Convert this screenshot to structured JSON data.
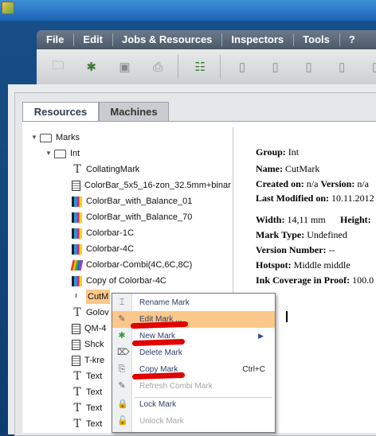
{
  "menubar": {
    "items": [
      "File",
      "Edit",
      "Jobs & Resources",
      "Inspectors",
      "Tools",
      "?"
    ]
  },
  "toolbar": {
    "icons": [
      "open-folder-icon",
      "add-resource-icon",
      "save-icon",
      "print-icon",
      "tree-icon",
      "doc-icon",
      "doc-icon",
      "doc-icon",
      "doc-icon",
      "doc-icon",
      "doc-icon",
      "doc-icon"
    ]
  },
  "tabs": {
    "resources": "Resources",
    "machines": "Machines"
  },
  "tree": {
    "root": "Marks",
    "folder": "Int",
    "items": [
      {
        "label": "CollatingMark"
      },
      {
        "label": "ColorBar_5x5_16-zon_32.5mm+binar"
      },
      {
        "label": "ColorBar_with_Balance_01"
      },
      {
        "label": "ColorBar_with_Balance_70"
      },
      {
        "label": "Colorbar-1C"
      },
      {
        "label": "Colorbar-4C"
      },
      {
        "label": "Colorbar-Combi(4C,6C,8C)"
      },
      {
        "label": "Copy of Colorbar-4C"
      },
      {
        "label": "CutM"
      },
      {
        "label": "Golov"
      },
      {
        "label": "QM-4"
      },
      {
        "label": "Shck"
      },
      {
        "label": "T-kre"
      },
      {
        "label": "Text"
      },
      {
        "label": "Text"
      },
      {
        "label": "Text"
      },
      {
        "label": "Text"
      }
    ]
  },
  "details": {
    "group_label": "Group:",
    "group_value": "Int",
    "name_label": "Name:",
    "name_value": "CutMark",
    "created_label": "Created on:",
    "created_value": "n/a",
    "version_label": "Version:",
    "version_value": "n/a",
    "modified_label": "Last Modified on:",
    "modified_value": "10.11.2012",
    "width_label": "Width:",
    "width_value": "14,11 mm",
    "height_label": "Height:",
    "marktype_label": "Mark Type:",
    "marktype_value": "Undefined",
    "vernum_label": "Version Number:",
    "vernum_value": "--",
    "hotspot_label": "Hotspot:",
    "hotspot_value": "Middle middle",
    "ink_label": "Ink Coverage in Proof:",
    "ink_value": "100.0"
  },
  "context_menu": {
    "items": [
      {
        "label": "Rename Mark",
        "icon": "rename-icon"
      },
      {
        "label": "Edit Mark ...",
        "icon": "edit-icon"
      },
      {
        "label": "New Mark",
        "icon": "new-icon",
        "submenu": true
      },
      {
        "label": "Delete Mark",
        "icon": "delete-icon"
      },
      {
        "label": "Copy Mark",
        "icon": "copy-icon",
        "shortcut": "Ctrl+C"
      },
      {
        "label": "Refresh Combi Mark",
        "icon": "refresh-icon",
        "disabled": true
      },
      {
        "label": "Lock Mark",
        "icon": "lock-icon"
      },
      {
        "label": "Unlock Mark",
        "icon": "unlock-icon",
        "disabled": true
      }
    ]
  },
  "colors": {
    "highlight": "#fbc78a",
    "annotation": "#e10000",
    "menubar": "#5b6878"
  }
}
